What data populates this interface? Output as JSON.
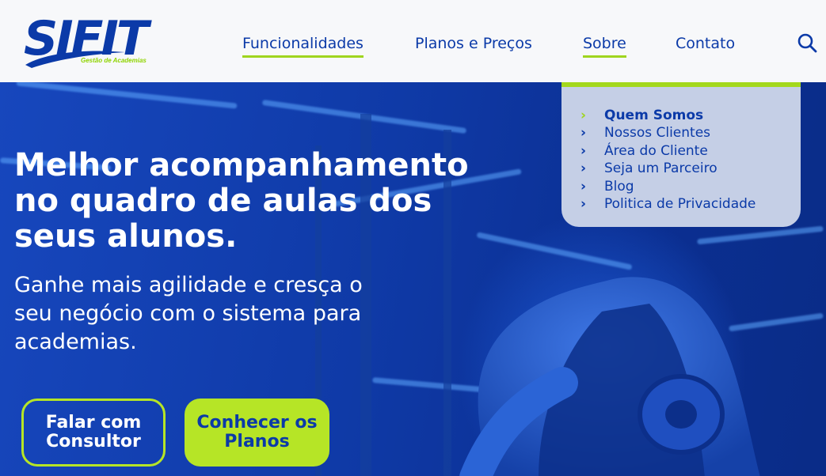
{
  "brand": {
    "logo_text": "SIFIT",
    "logo_tagline": "Gestão de Academias",
    "primary_color": "#0b3aa8",
    "accent_color": "#b6e526"
  },
  "nav": {
    "items": [
      {
        "label": "Funcionalidades",
        "active": true
      },
      {
        "label": "Planos e Preços",
        "active": false
      },
      {
        "label": "Sobre",
        "active": true
      },
      {
        "label": "Contato",
        "active": false
      }
    ],
    "search_icon": "search-icon"
  },
  "dropdown": {
    "items": [
      {
        "label": "Quem Somos",
        "current": true
      },
      {
        "label": "Nossos Clientes",
        "current": false
      },
      {
        "label": "Área do Cliente",
        "current": false
      },
      {
        "label": "Seja um Parceiro",
        "current": false
      },
      {
        "label": "Blog",
        "current": false
      },
      {
        "label": "Politica de Privacidade",
        "current": false
      }
    ],
    "chevron_icon": "chevron-right-icon"
  },
  "hero": {
    "headline": "Melhor acompanhamento no quadro de aulas dos seus alunos.",
    "subtext": "Ganhe mais agilidade e cresça o seu negócio com o sistema para academias.",
    "buttons": {
      "consultor": "Falar com Consultor",
      "planos": "Conhecer os Planos"
    }
  }
}
